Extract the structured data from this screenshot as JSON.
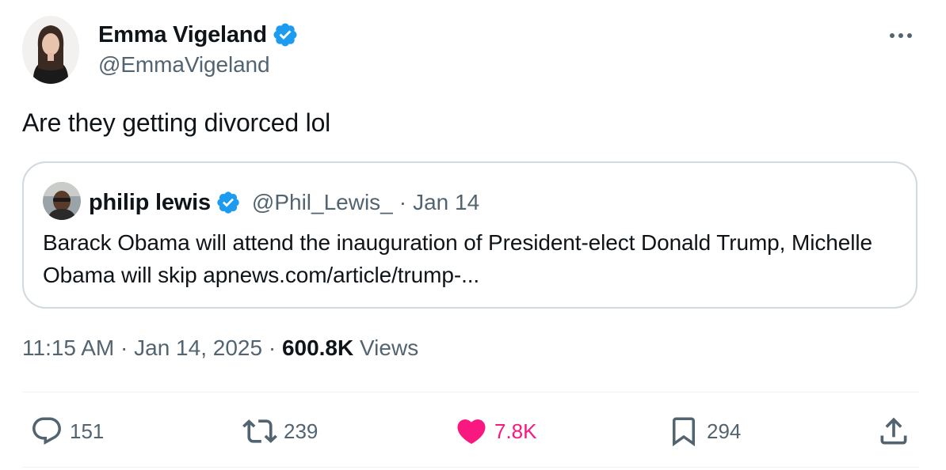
{
  "author": {
    "display_name": "Emma Vigeland",
    "handle": "@EmmaVigeland",
    "verified": true
  },
  "tweet": {
    "text": "Are they getting divorced lol"
  },
  "quote": {
    "display_name": "philip lewis",
    "handle": "@Phil_Lewis_",
    "separator": "·",
    "date": "Jan 14",
    "text": "Barack Obama will attend the inauguration of President-elect Donald Trump, Michelle Obama will skip apnews.com/article/trump-..."
  },
  "meta": {
    "time": "11:15 AM",
    "sep1": " · ",
    "date": "Jan 14, 2025",
    "sep2": " · ",
    "views_count": "600.8K",
    "views_label": " Views"
  },
  "actions": {
    "replies": "151",
    "reposts": "239",
    "likes": "7.8K",
    "bookmarks": "294"
  },
  "icons": {
    "verified": "verified-badge-icon",
    "more": "more-options-icon",
    "reply": "reply-icon",
    "repost": "repost-icon",
    "like": "heart-icon",
    "bookmark": "bookmark-icon",
    "share": "share-icon"
  },
  "colors": {
    "verified": "#1d9bf0",
    "like": "#f91880",
    "secondary_text": "#536471",
    "border": "#cfd9de"
  }
}
